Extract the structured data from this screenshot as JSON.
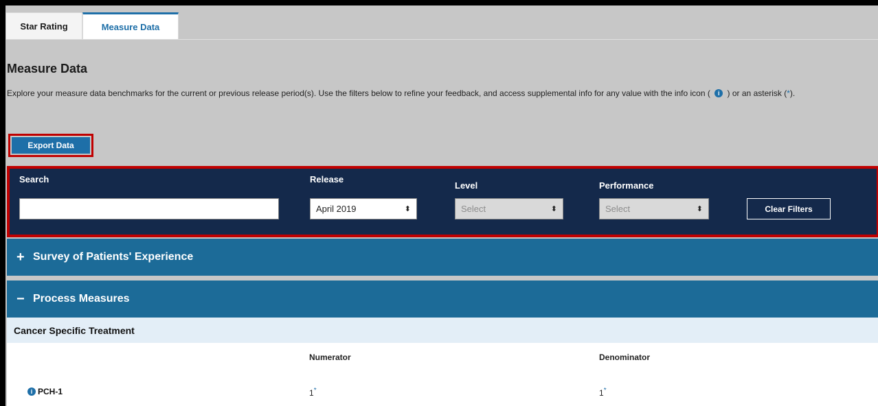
{
  "tabs": [
    {
      "label": "Star Rating"
    },
    {
      "label": "Measure Data"
    }
  ],
  "page": {
    "title": "Measure Data",
    "intro_before_icon": "Explore your measure data benchmarks for the current or previous release period(s). Use the filters below to refine your feedback, and access supplemental info for any value with the info icon (",
    "intro_after_icon": ") or an asterisk (",
    "intro_asterisk": "*",
    "intro_end": ").",
    "info_icon_glyph": "i"
  },
  "export": {
    "label": "Export Data"
  },
  "filters": {
    "search": {
      "label": "Search",
      "value": ""
    },
    "release": {
      "label": "Release",
      "value": "April 2019"
    },
    "level": {
      "label": "Level",
      "value": "Select"
    },
    "performance": {
      "label": "Performance",
      "value": "Select"
    },
    "clear_label": "Clear Filters"
  },
  "sections": [
    {
      "sign": "+",
      "title": "Survey of Patients' Experience"
    },
    {
      "sign": "−",
      "title": "Process Measures"
    }
  ],
  "subsection": {
    "title": "Cancer Specific Treatment"
  },
  "table": {
    "headers": {
      "numerator": "Numerator",
      "denominator": "Denominator"
    },
    "rows": [
      {
        "measure": "PCH-1",
        "numerator": "1",
        "denominator": "1",
        "asterisk": "*"
      }
    ]
  },
  "colors": {
    "accent": "#1e6fa8",
    "filter_bar": "#14294b",
    "section_bar": "#1c6b98",
    "highlight": "#c00000"
  }
}
